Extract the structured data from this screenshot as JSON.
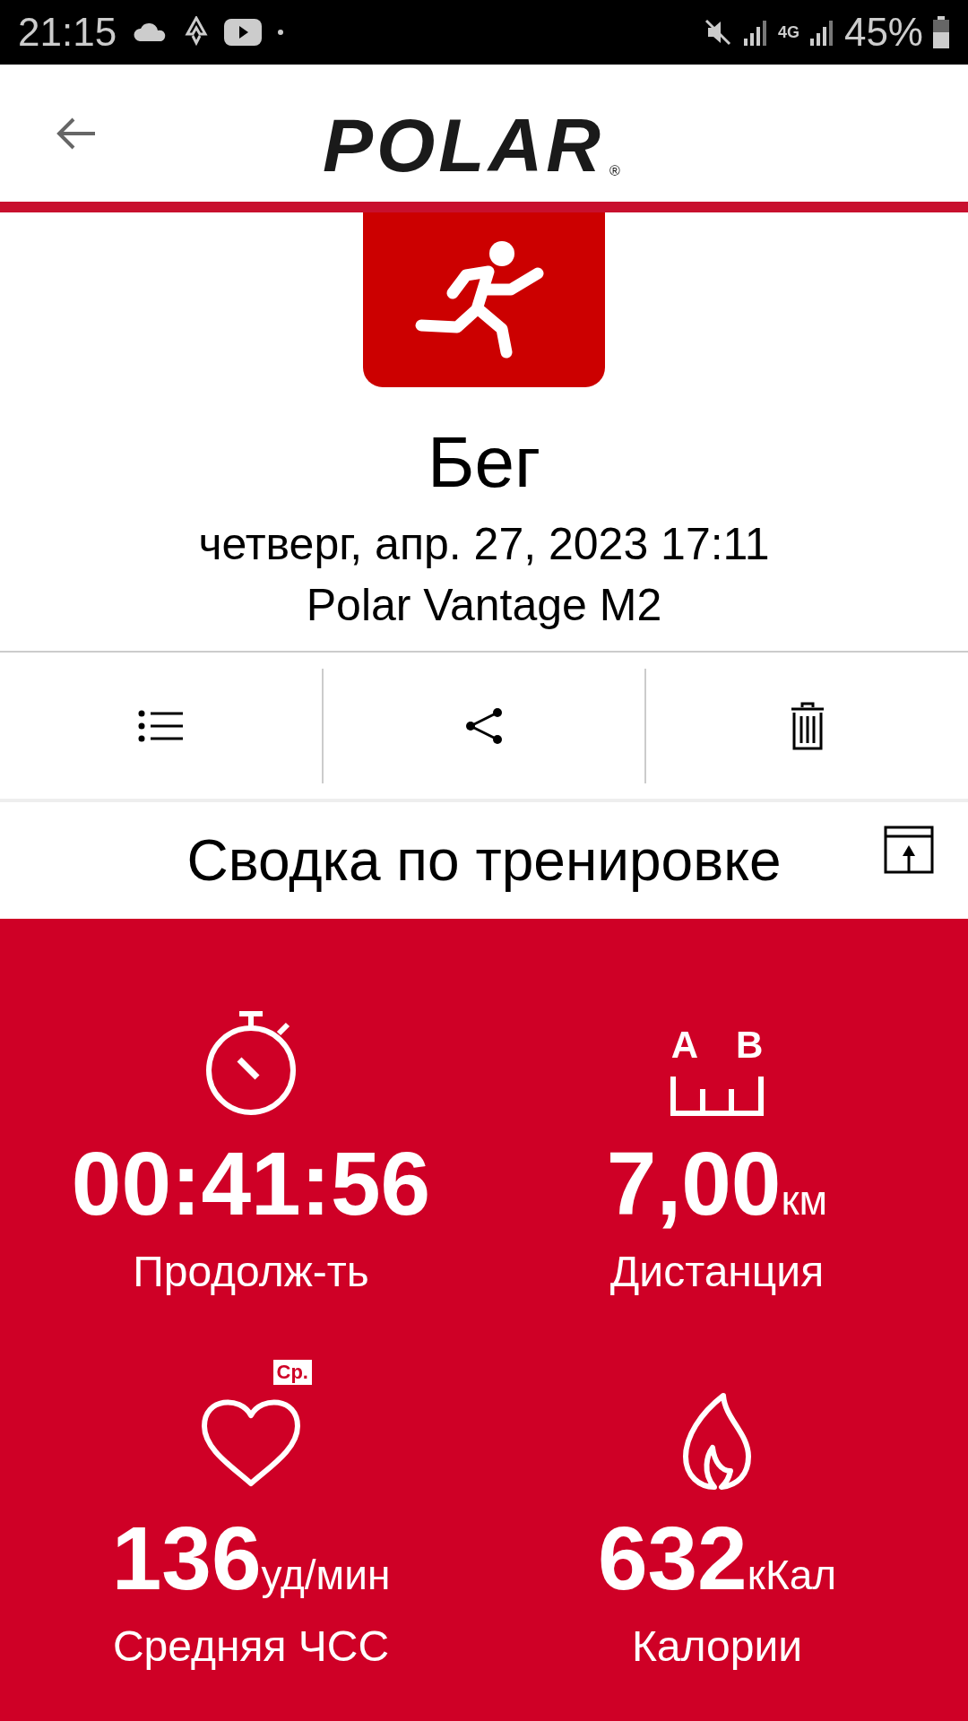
{
  "status_bar": {
    "time": "21:15",
    "network": "4G",
    "battery": "45%"
  },
  "header": {
    "logo": "POLAR",
    "logo_mark": "®"
  },
  "sport": {
    "name": "Бег",
    "date": "четверг, апр. 27, 2023 17:11",
    "device": "Polar Vantage M2"
  },
  "actions": [
    {
      "kind": "list"
    },
    {
      "kind": "share"
    },
    {
      "kind": "delete"
    }
  ],
  "summary": {
    "title": "Сводка по тренировке",
    "stats": [
      {
        "kind": "duration",
        "value": "00:41:56",
        "label": "Продолж-ть"
      },
      {
        "kind": "distance",
        "markers": [
          "A",
          "B"
        ],
        "value": "7,00",
        "unit": "км",
        "label": "Дистанция"
      },
      {
        "kind": "heart_rate",
        "badge": "Ср.",
        "value": "136",
        "unit": "уд/мин",
        "label": "Средняя ЧСС"
      },
      {
        "kind": "calories",
        "value": "632",
        "unit": "кКал",
        "label": "Калории"
      }
    ]
  }
}
